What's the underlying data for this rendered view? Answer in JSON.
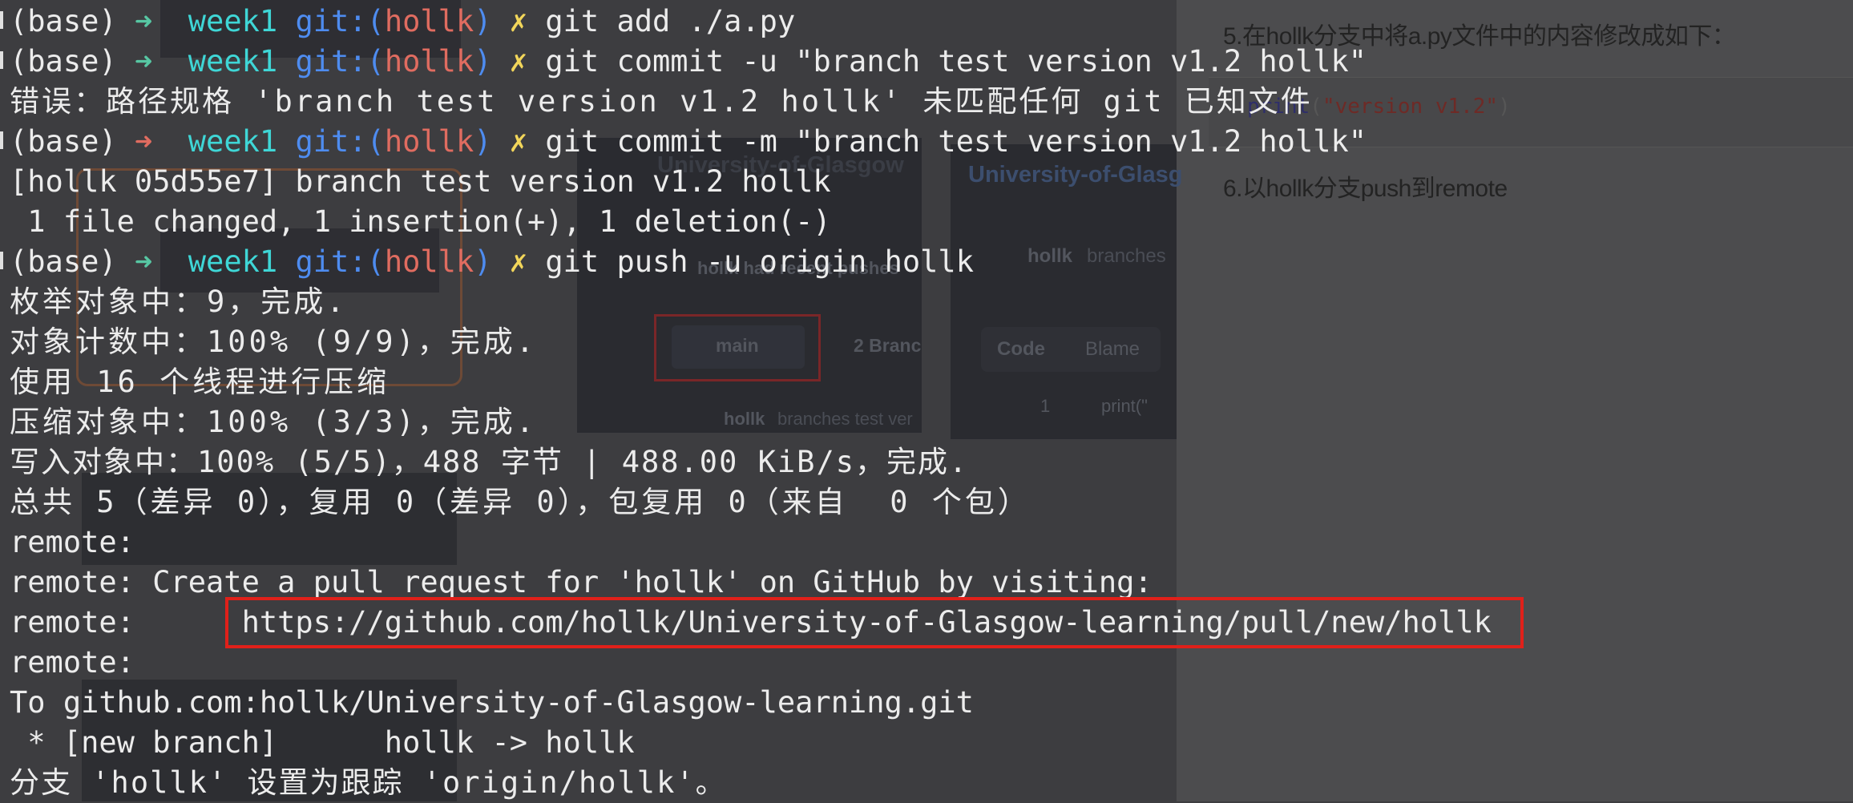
{
  "blog": {
    "step5": "5.在hollk分支中将a.py文件中的内容修改成如下：",
    "code": {
      "func": "print",
      "open": "(",
      "str": "\"version v1.2\"",
      "close": ")"
    },
    "step6": "6.以hollk分支push到remote"
  },
  "ghost": {
    "repo_title": "University-of-Glasgow",
    "repo_title_right": "University-of-Glasg",
    "branch_button": "main",
    "branches_count": "2 Branc",
    "user": "hollk",
    "branches_label": "branches",
    "commit_text": "branches test ver",
    "pushed_text": "hollk had recent pushes",
    "code_tab": "Code",
    "blame_tab": "Blame",
    "line_no": "1",
    "line_code": "print(\""
  },
  "terminal": {
    "prompt": {
      "env": "(base)",
      "arrow": "➜",
      "dir": "week1",
      "git_label": "git:(",
      "branch": "hollk",
      "git_close": ")",
      "dirty": "✗"
    },
    "commands": [
      "git add ./a.py",
      "git commit -u \"branch test version v1.2 hollk\"",
      "git commit -m \"branch test version v1.2 hollk\"",
      "git push -u origin hollk"
    ],
    "output": {
      "error_line": "错误：路径规格 'branch test version v1.2 hollk' 未匹配任何 git 已知文件",
      "commit_result": "[hollk 05d55e7] branch test version v1.2 hollk",
      "changed": " 1 file changed, 1 insertion(+), 1 deletion(-)",
      "enum": "枚举对象中：9，完成.",
      "count": "对象计数中：100% (9/9)，完成.",
      "threads": "使用 16 个线程进行压缩",
      "compress": "压缩对象中：100% (3/3)，完成.",
      "write": "写入对象中：100% (5/5)，488 字节 | 488.00 KiB/s，完成.",
      "total": "总共 5（差异 0），复用 0（差异 0），包复用 0（来自  0 个包）",
      "remote_blank": "remote:",
      "remote_create": "remote: Create a pull request for 'hollk' on GitHub by visiting:",
      "remote_url_prefix": "remote:      ",
      "remote_url": "https://github.com/hollk/University-of-Glasgow-learning/pull/new/hollk",
      "remote_blank2": "remote:",
      "to_line": "To github.com:hollk/University-of-Glasgow-learning.git",
      "new_branch": " * [new branch]      hollk -> hollk",
      "tracking": "分支 'hollk' 设置为跟踪 'origin/hollk'。"
    }
  }
}
